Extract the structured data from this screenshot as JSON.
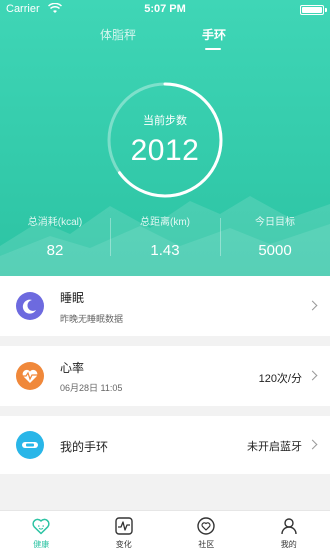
{
  "status_bar": {
    "carrier": "Carrier",
    "time": "5:07 PM"
  },
  "tabs": [
    {
      "label": "体脂秤",
      "active": false
    },
    {
      "label": "手环",
      "active": true
    }
  ],
  "steps": {
    "label": "当前步数",
    "value": "2012",
    "progress": 0.65
  },
  "stats": [
    {
      "label": "总消耗(kcal)",
      "value": "82"
    },
    {
      "label": "总距离(km)",
      "value": "1.43"
    },
    {
      "label": "今日目标",
      "value": "5000"
    }
  ],
  "cards": {
    "sleep": {
      "title": "睡眠",
      "subtitle": "昨晚无睡眠数据",
      "icon": "moon-icon",
      "color": "#6d6adf"
    },
    "heart": {
      "title": "心率",
      "subtitle": "06月28日 11:05",
      "value": "120次/分",
      "icon": "heart-pulse-icon",
      "color": "#f0883a"
    },
    "band": {
      "title": "我的手环",
      "value": "未开启蓝牙",
      "icon": "band-icon",
      "color": "#29b6e8"
    }
  },
  "tabbar": [
    {
      "label": "健康",
      "icon": "health-heart-icon",
      "active": true
    },
    {
      "label": "变化",
      "icon": "activity-icon",
      "active": false
    },
    {
      "label": "社区",
      "icon": "community-heart-icon",
      "active": false
    },
    {
      "label": "我的",
      "icon": "user-icon",
      "active": false
    }
  ],
  "colors": {
    "primary": "#2cc3a3",
    "hero_top": "#3fd6b6"
  }
}
